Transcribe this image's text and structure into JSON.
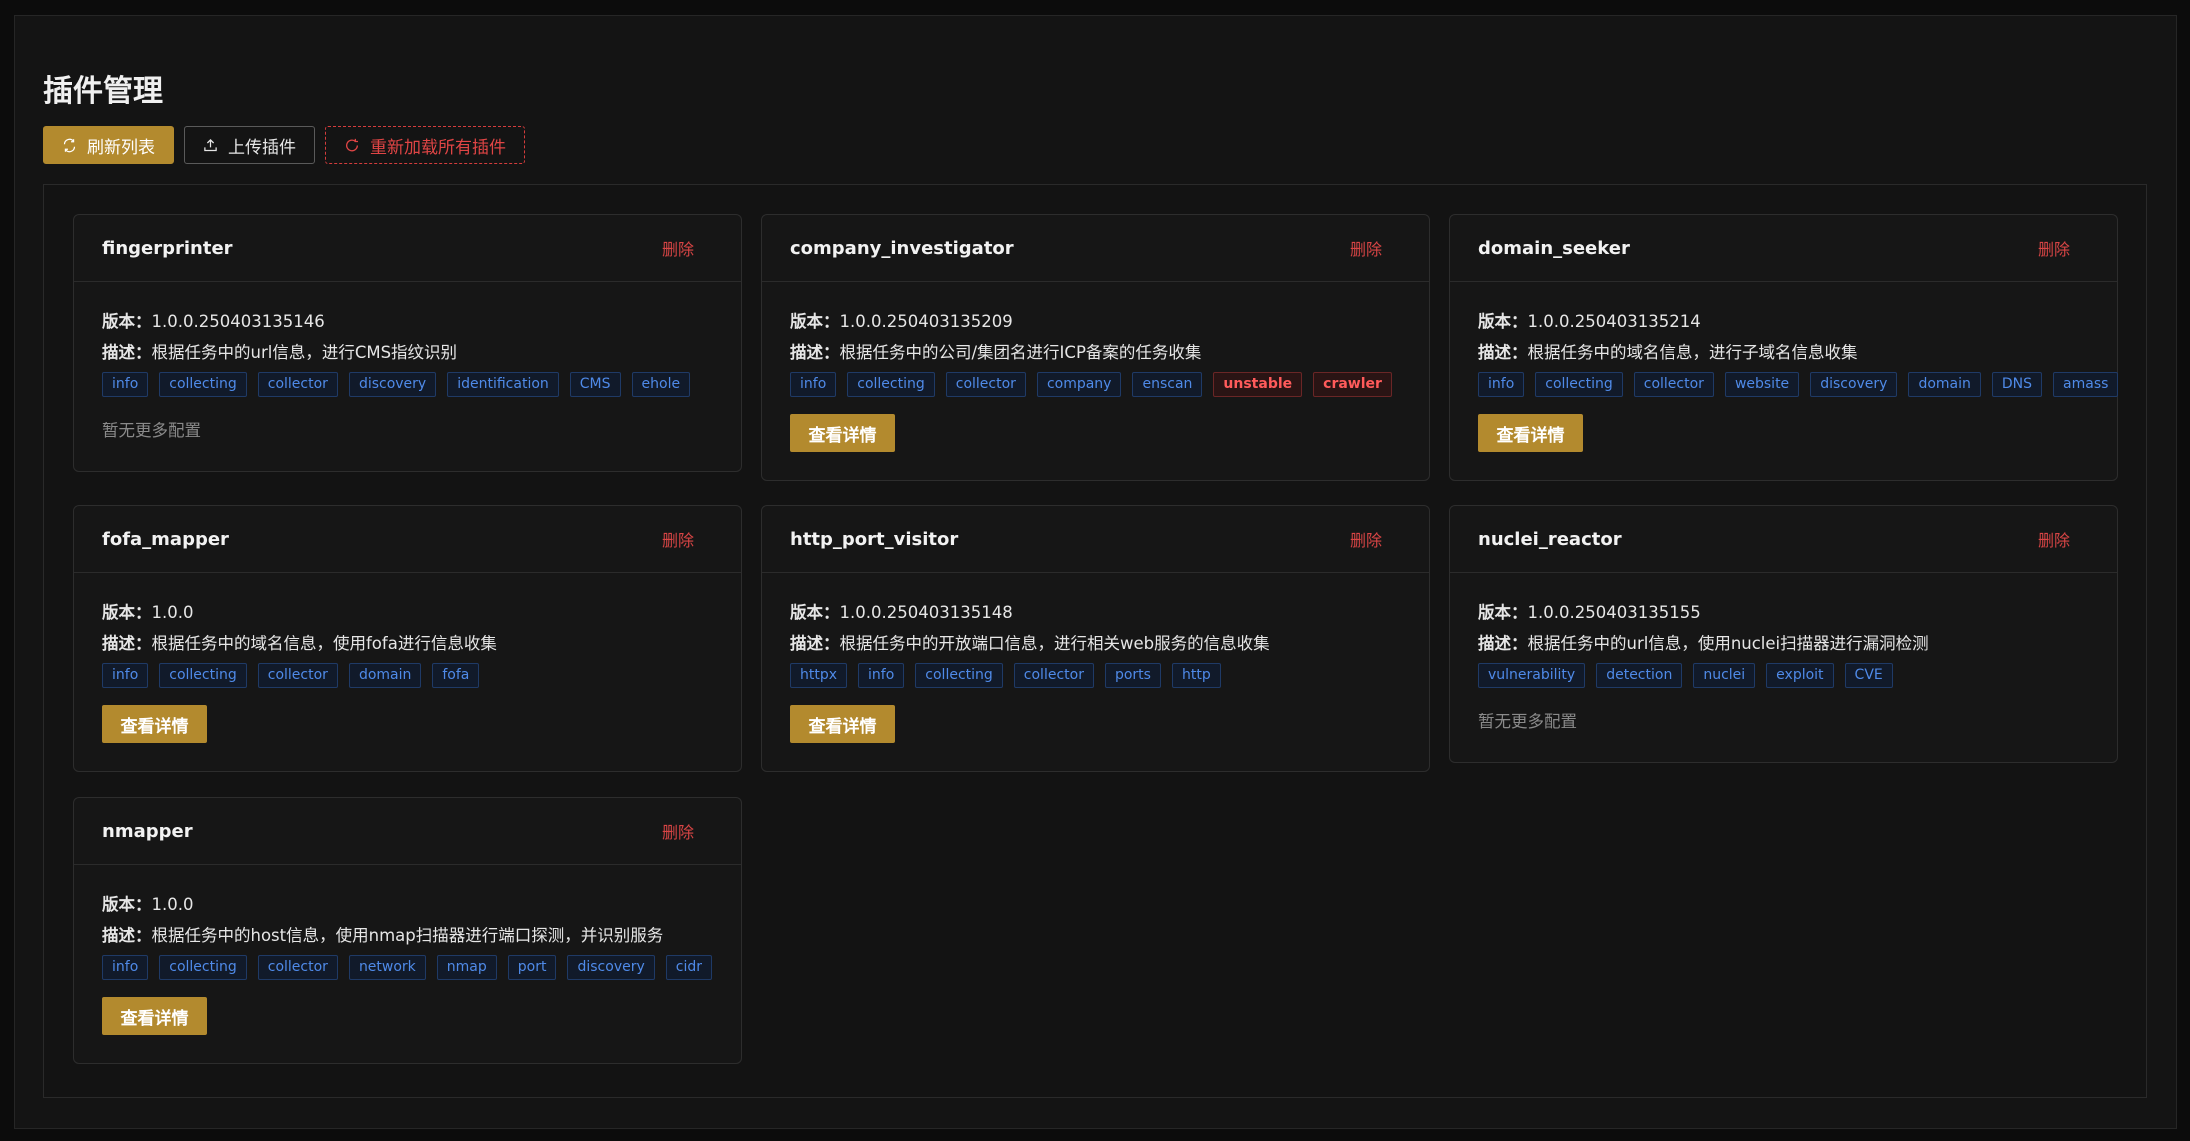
{
  "page": {
    "title": "插件管理"
  },
  "toolbar": {
    "refresh_label": "刷新列表",
    "upload_label": "上传插件",
    "reload_label": "重新加载所有插件"
  },
  "labels": {
    "version": "版本：",
    "description": "描述：",
    "delete": "删除",
    "detail": "查看详情",
    "no_config": "暂无更多配置"
  },
  "colors": {
    "accent": "#b38a2e",
    "danger": "#d84545",
    "tag": "#4f8ae8"
  },
  "plugins": [
    {
      "name": "fingerprinter",
      "version": "1.0.0.250403135146",
      "description": "根据任务中的url信息，进行CMS指纹识别",
      "tags": [
        "info",
        "collecting",
        "collector",
        "discovery",
        "identification",
        "CMS",
        "ehole"
      ],
      "warn_tags": [],
      "has_detail": false
    },
    {
      "name": "company_investigator",
      "version": "1.0.0.250403135209",
      "description": "根据任务中的公司/集团名进行ICP备案的任务收集",
      "tags": [
        "info",
        "collecting",
        "collector",
        "company",
        "enscan"
      ],
      "warn_tags": [
        "unstable",
        "crawler"
      ],
      "has_detail": true
    },
    {
      "name": "domain_seeker",
      "version": "1.0.0.250403135214",
      "description": "根据任务中的域名信息，进行子域名信息收集",
      "tags": [
        "info",
        "collecting",
        "collector",
        "website",
        "discovery",
        "domain",
        "DNS",
        "amass"
      ],
      "warn_tags": [],
      "has_detail": true
    },
    {
      "name": "fofa_mapper",
      "version": "1.0.0",
      "description": "根据任务中的域名信息，使用fofa进行信息收集",
      "tags": [
        "info",
        "collecting",
        "collector",
        "domain",
        "fofa"
      ],
      "warn_tags": [],
      "has_detail": true
    },
    {
      "name": "http_port_visitor",
      "version": "1.0.0.250403135148",
      "description": "根据任务中的开放端口信息，进行相关web服务的信息收集",
      "tags": [
        "httpx",
        "info",
        "collecting",
        "collector",
        "ports",
        "http"
      ],
      "warn_tags": [],
      "has_detail": true
    },
    {
      "name": "nuclei_reactor",
      "version": "1.0.0.250403135155",
      "description": "根据任务中的url信息，使用nuclei扫描器进行漏洞检测",
      "tags": [
        "vulnerability",
        "detection",
        "nuclei",
        "exploit",
        "CVE"
      ],
      "warn_tags": [],
      "has_detail": false
    },
    {
      "name": "nmapper",
      "version": "1.0.0",
      "description": "根据任务中的host信息，使用nmap扫描器进行端口探测，并识别服务",
      "tags": [
        "info",
        "collecting",
        "collector",
        "network",
        "nmap",
        "port",
        "discovery",
        "cidr"
      ],
      "warn_tags": [],
      "has_detail": true
    }
  ]
}
